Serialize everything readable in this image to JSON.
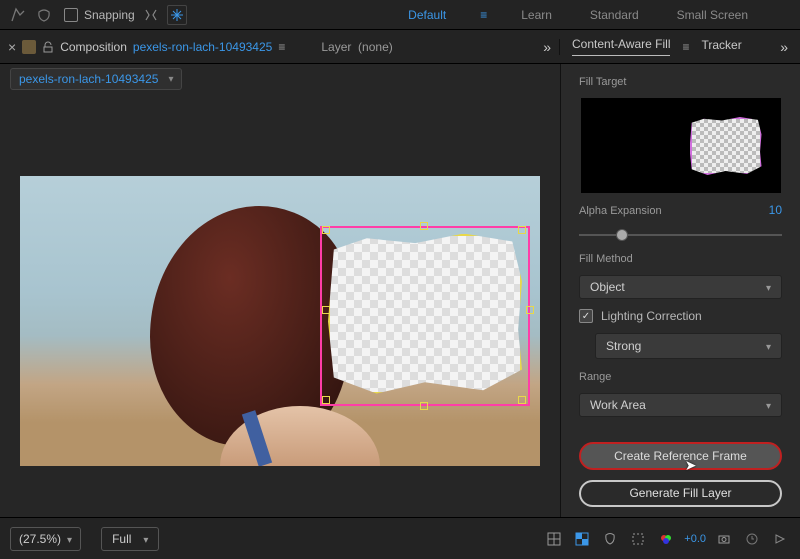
{
  "topbar": {
    "snapping_label": "Snapping",
    "workspaces": {
      "default": "Default",
      "learn": "Learn",
      "standard": "Standard",
      "small_screen": "Small Screen"
    }
  },
  "panel_headers": {
    "composition_label": "Composition",
    "composition_name": "pexels-ron-lach-10493425",
    "layer_label": "Layer",
    "layer_value": "(none)",
    "caf_tab": "Content-Aware Fill",
    "tracker_tab": "Tracker"
  },
  "comp_dropdown": {
    "name": "pexels-ron-lach-10493425"
  },
  "caf_panel": {
    "fill_target_label": "Fill Target",
    "alpha_expansion_label": "Alpha Expansion",
    "alpha_expansion_value": "10",
    "fill_method_label": "Fill Method",
    "fill_method_value": "Object",
    "lighting_correction_label": "Lighting Correction",
    "lighting_strength_value": "Strong",
    "range_label": "Range",
    "range_value": "Work Area",
    "create_ref_label": "Create Reference Frame",
    "generate_label": "Generate Fill Layer"
  },
  "bottombar": {
    "zoom": "(27.5%)",
    "resolution": "Full",
    "exposure": "+0.0"
  }
}
